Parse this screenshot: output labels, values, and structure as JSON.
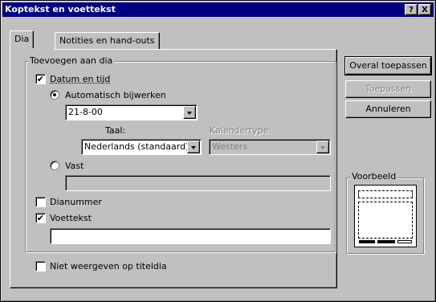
{
  "window": {
    "title": "Koptekst en voettekst",
    "help_button": "?",
    "close_button": "X"
  },
  "tabs": [
    {
      "label": "Dia",
      "active": true
    },
    {
      "label": "Notities en hand-outs",
      "active": false
    }
  ],
  "add_group": {
    "label": "Toevoegen aan dia",
    "date_time": {
      "label": "Datum en tijd",
      "checked": true
    },
    "auto_update": {
      "label": "Automatisch bijwerken",
      "selected": true,
      "value": "21-8-00"
    },
    "language": {
      "label": "Taal:",
      "value": "Nederlands (standaard)"
    },
    "calendar": {
      "label": "Kalendertype:",
      "value": "Westers",
      "enabled": false
    },
    "fixed": {
      "label": "Vast",
      "selected": false,
      "value": ""
    },
    "slide_number": {
      "label": "Dianummer",
      "checked": false
    },
    "footer": {
      "label": "Voettekst",
      "checked": true,
      "value": ""
    }
  },
  "no_title_slide": {
    "label": "Niet weergeven op titeldia",
    "checked": false
  },
  "buttons": {
    "apply_all": "Overal toepassen",
    "apply": "Toepassen",
    "cancel": "Annuleren"
  },
  "preview": {
    "label": "Voorbeeld"
  }
}
